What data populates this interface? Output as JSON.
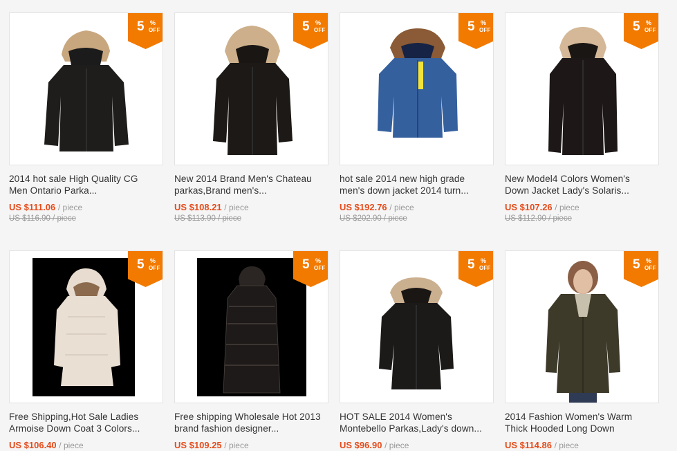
{
  "badge": {
    "number": "5",
    "percent": "%",
    "off": "OFF"
  },
  "colors": {
    "badge": "#f27a00",
    "price": "#e64b1a",
    "muted": "#999999"
  },
  "products": [
    {
      "title_l1": "2014 hot sale High Quality CG",
      "title_l2": "Men Ontario Parka...",
      "price": "US $111.06",
      "unit": "/ piece",
      "old_price": "US $116.90 / piece",
      "image": "black-parka-fur-hood"
    },
    {
      "title_l1": "New 2014 Brand Men's Chateau",
      "title_l2": "parkas,Brand men's...",
      "price": "US $108.21",
      "unit": "/ piece",
      "old_price": "US $113.90 / piece",
      "image": "black-parka-fur-hood"
    },
    {
      "title_l1": "hot sale 2014 new high grade",
      "title_l2": "men's down jacket 2014 turn...",
      "price": "US $192.76",
      "unit": "/ piece",
      "old_price": "US $202.90 / piece",
      "image": "blue-down-jacket"
    },
    {
      "title_l1": "New Model4 Colors Women's",
      "title_l2": "Down Jacket Lady's Solaris...",
      "price": "US $107.26",
      "unit": "/ piece",
      "old_price": "US $112.90 / piece",
      "image": "black-womens-jacket"
    },
    {
      "title_l1": "Free Shipping,Hot Sale Ladies",
      "title_l2": "Armoise Down Coat 3 Colors...",
      "price": "US $106.40",
      "unit": "/ piece",
      "old_price": "",
      "image": "white-puffer-coat"
    },
    {
      "title_l1": "Free shipping Wholesale Hot 2013",
      "title_l2": "brand fashion designer...",
      "price": "US $109.25",
      "unit": "/ piece",
      "old_price": "",
      "image": "black-long-puffer"
    },
    {
      "title_l1": "HOT SALE 2014 Women's",
      "title_l2": "Montebello Parkas,Lady's down...",
      "price": "US $96.90",
      "unit": "/ piece",
      "old_price": "",
      "image": "black-womens-parka"
    },
    {
      "title_l1": "2014 Fashion Women's Warm",
      "title_l2": "Thick Hooded Long Down",
      "price": "US $114.86",
      "unit": "/ piece",
      "old_price": "",
      "image": "olive-waxed-jacket"
    }
  ]
}
